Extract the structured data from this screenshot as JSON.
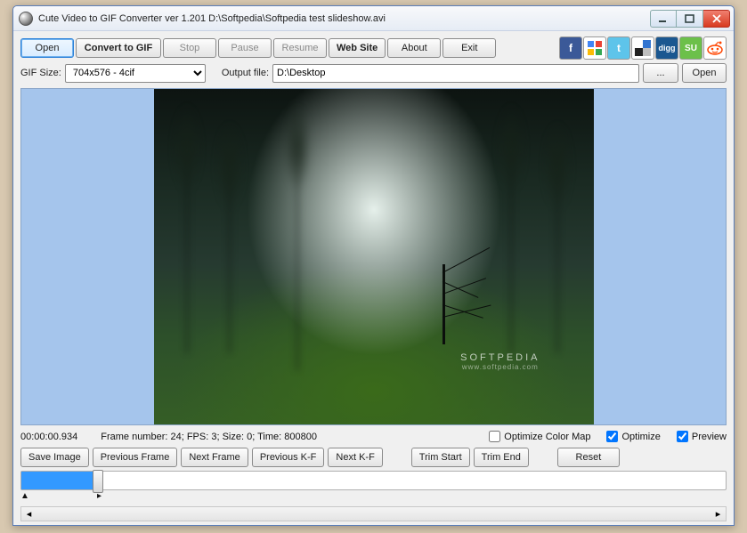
{
  "window": {
    "title": "Cute Video to GIF Converter ver 1.201  D:\\Softpedia\\Softpedia test slideshow.avi"
  },
  "toolbar": {
    "open": "Open",
    "convert": "Convert to GIF",
    "stop": "Stop",
    "pause": "Pause",
    "resume": "Resume",
    "website": "Web Site",
    "about": "About",
    "exit": "Exit"
  },
  "social": {
    "facebook": "f",
    "google": "",
    "twitter": "t",
    "delicious": "",
    "digg": "digg",
    "stumble": "SU",
    "reddit": ""
  },
  "gifsize": {
    "label": "GIF Size:",
    "value": "704x576 - 4cif"
  },
  "output": {
    "label": "Output file:",
    "value": "D:\\Desktop",
    "browse": "...",
    "open": "Open"
  },
  "preview_overlay": {
    "brand": "SOFTPEDIA",
    "sub": "www.softpedia.com"
  },
  "status": {
    "time": "00:00:00.934",
    "frameinfo": "Frame number: 24; FPS: 3; Size: 0; Time: 800800"
  },
  "checks": {
    "optimizecm": "Optimize Color Map",
    "optimize": "Optimize",
    "preview": "Preview"
  },
  "framebtns": {
    "save": "Save Image",
    "prev": "Previous Frame",
    "next": "Next Frame",
    "prevkf": "Previous K-F",
    "nextkf": "Next K-F",
    "trimstart": "Trim Start",
    "trimend": "Trim End",
    "reset": "Reset"
  }
}
